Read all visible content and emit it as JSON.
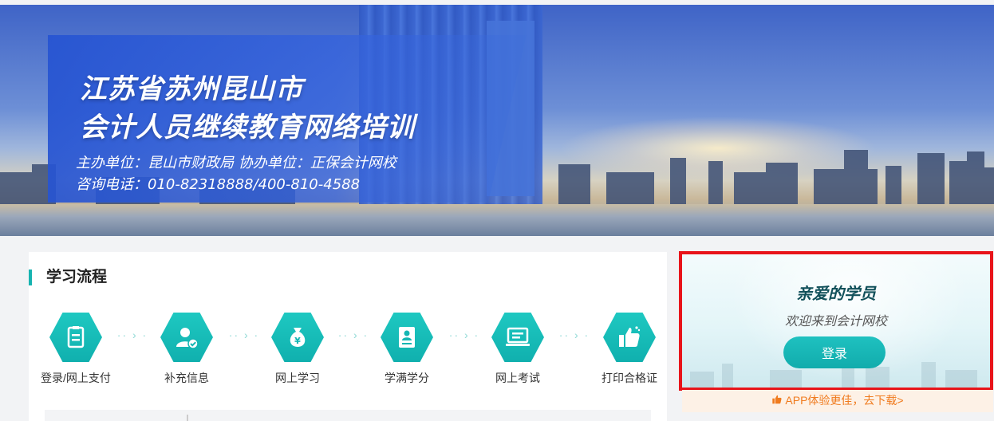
{
  "banner": {
    "title_line1": "江苏省苏州昆山市",
    "title_line2": "会计人员继续教育网络培训",
    "info_line1": "主办单位：昆山市财政局    协办单位：正保会计网校",
    "info_line2": "咨询电话：010-82318888/400-810-4588"
  },
  "process": {
    "title": "学习流程",
    "steps": [
      {
        "label": "登录/网上支付",
        "icon": "checklist-icon"
      },
      {
        "label": "补充信息",
        "icon": "user-check-icon"
      },
      {
        "label": "网上学习",
        "icon": "money-bag-icon"
      },
      {
        "label": "学满学分",
        "icon": "certificate-icon"
      },
      {
        "label": "网上考试",
        "icon": "laptop-icon"
      },
      {
        "label": "打印合格证",
        "icon": "thumbs-up-icon"
      }
    ]
  },
  "login": {
    "title": "亲爱的学员",
    "subtitle": "欢迎来到会计网校",
    "button_label": "登录"
  },
  "app_promo": {
    "text": "APP体验更佳，去下载>"
  },
  "colors": {
    "accent": "#16b3b0",
    "highlight_border": "#e8141a",
    "promo_text": "#f07b1e"
  }
}
